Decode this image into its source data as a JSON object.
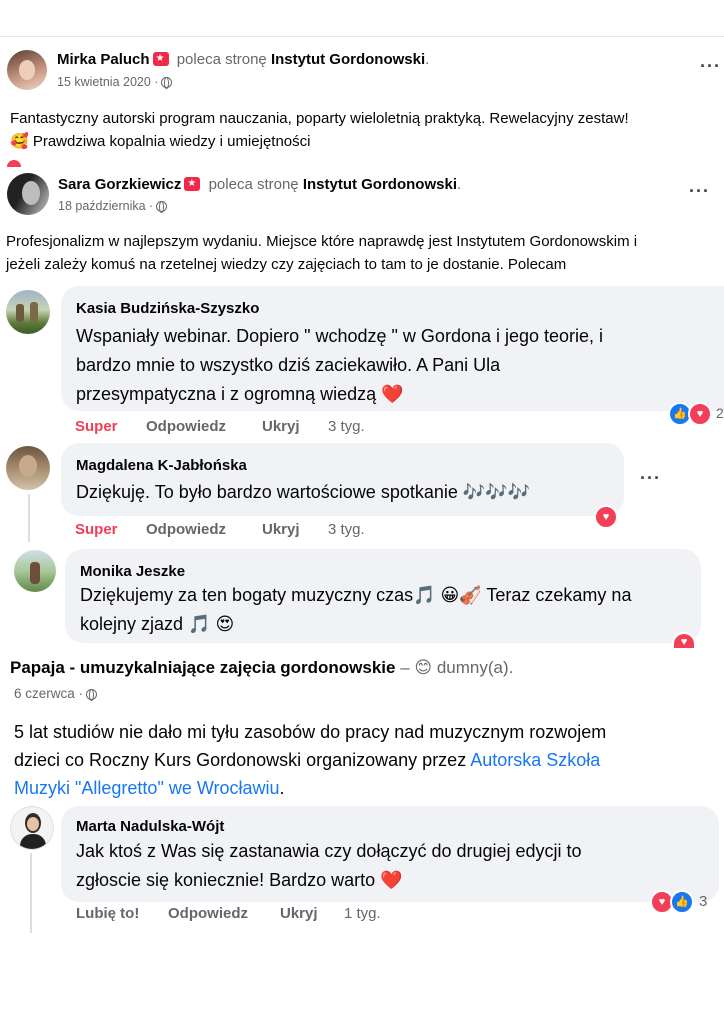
{
  "post1": {
    "author": "Mirka Paluch",
    "verb": "poleca stronę",
    "page": "Instytut Gordonowski",
    "date": "15 kwietnia 2020 ·",
    "text_line1": "Fantastyczny autorski program nauczania, poparty wieloletnią praktyką. Rewelacyjny zestaw!",
    "text_line2": "🥰 Prawdziwa kopalnia wiedzy i umiejętności"
  },
  "post2": {
    "author": "Sara Gorzkiewicz",
    "verb": "poleca stronę",
    "page": "Instytut Gordonowski",
    "date": "18 października ·",
    "text_line1": "Profesjonalizm w najlepszym wydaniu. Miejsce które naprawdę jest Instytutem Gordonowskim i",
    "text_line2": "jeżeli zależy komuś na rzetelnej wiedzy czy zajęciach to tam to je dostanie. Polecam"
  },
  "comments": [
    {
      "author": "Kasia Budzińska-Szyszko",
      "line1": "Wspaniały webinar. Dopiero \" wchodzę \" w Gordona i jego teorie, i",
      "line2": "bardzo mnie to wszystko dziś zaciekawiło. A Pani Ula",
      "line3": "przesympatyczna i z ogromną wiedzą ❤️",
      "reaction_label": "Super",
      "reply": "Odpowiedz",
      "hide": "Ukryj",
      "time": "3 tyg.",
      "reaction_count": "2"
    },
    {
      "author": "Magdalena K-Jabłońska",
      "line1": "Dziękuję. To było bardzo wartościowe spotkanie 🎶🎶🎶",
      "reaction_label": "Super",
      "reply": "Odpowiedz",
      "hide": "Ukryj",
      "time": "3 tyg."
    },
    {
      "author": "Monika Jeszke",
      "line1": "Dziękujemy za ten bogaty muzyczny czas🎵 😀🎻 Teraz czekamy na",
      "line2": "kolejny zjazd 🎵 😍"
    }
  ],
  "post3": {
    "author": "Papaja - umuzykalniające zajęcia gordonowskie",
    "feeling": "– 😊 dumny(a).",
    "date": "6 czerwca ·",
    "text_line1": "5 lat studiów nie dało mi tyłu zasobów do pracy nad muzycznym rozwojem",
    "text_line2_prefix": "dzieci co Roczny Kurs Gordonowski organizowany przez",
    "link_part1": "Autorska Szkoła",
    "link_part2": "Muzyki \"Allegretto\" we Wrocławiu",
    "text_line3_suffix": "."
  },
  "comment4": {
    "author": "Marta Nadulska-Wójt",
    "line1": "Jak ktoś z Was się zastanawia czy dołączyć do drugiej edycji to",
    "line2": "zgłoscie się koniecznie! Bardzo warto ❤️",
    "like": "Lubię to!",
    "reply": "Odpowiedz",
    "hide": "Ukryj",
    "time": "1 tyg.",
    "reaction_count": "3"
  },
  "icons": {
    "more": "more-options-icon",
    "globe": "globe-icon",
    "recommend": "recommend-badge-icon",
    "like": "like-reaction-icon",
    "love": "love-reaction-icon"
  },
  "colors": {
    "link": "#1877f2",
    "super": "#f33e58",
    "muted": "#65676b",
    "bubble": "#f0f2f5"
  }
}
